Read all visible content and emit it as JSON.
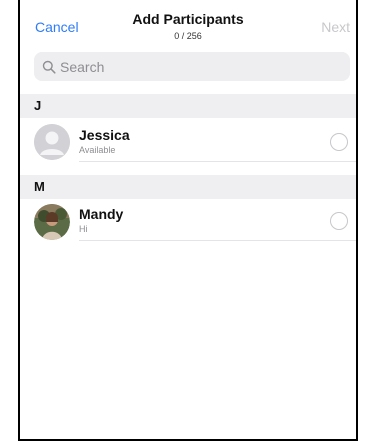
{
  "nav": {
    "cancel_label": "Cancel",
    "title": "Add Participants",
    "count": "0 / 256",
    "next_label": "Next"
  },
  "search": {
    "placeholder": "Search",
    "icon": "search-icon"
  },
  "sections": [
    {
      "letter": "J",
      "contacts": [
        {
          "name": "Jessica",
          "status": "Available",
          "avatar": "default-avatar-icon",
          "selected": false
        }
      ]
    },
    {
      "letter": "M",
      "contacts": [
        {
          "name": "Mandy",
          "status": "Hi",
          "avatar": "photo-avatar",
          "selected": false
        }
      ]
    }
  ],
  "colors": {
    "accent": "#2f7cf6",
    "disabled": "#c8c8cc",
    "section_bg": "#efeff2",
    "search_bg": "#eeeef0"
  }
}
